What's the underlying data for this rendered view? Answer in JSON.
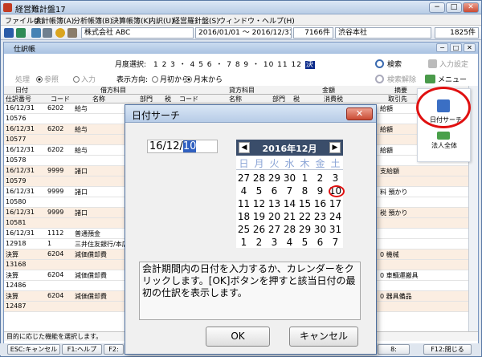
{
  "app": {
    "title": "経営難計盤17",
    "min": "−",
    "max": "□",
    "close": "✕"
  },
  "menu": [
    "ファイル(F)",
    "会計帳簿(A)",
    "分析帳簿(B)",
    "決算帳簿(K)",
    "内訳(U)",
    "経営羅針盤(S)",
    "ウィンドウ・ヘルプ(H)"
  ],
  "toolbar": {
    "company": "株式会社 ABC",
    "period": "2016/01/01 ～ 2016/12/31",
    "count": "7166件",
    "branch": "渋谷本社",
    "count2": "1825件"
  },
  "journal": {
    "title": "仕訳帳",
    "month_label": "月度選択:",
    "months": "1 2 3 ・ 4 5 6 ・ 7 8 9 ・ 10 11 12",
    "month_selected": "決",
    "direction_label": "表示方向:",
    "from_start": "月初から",
    "from_end": "月末から",
    "process_label": "処理",
    "reference": "参照",
    "input": "入力",
    "search": "検索",
    "search_amend": "検索解除",
    "input_settings": "入力設定",
    "menu": "メニュー",
    "headers_top": [
      "日付",
      "借方科目",
      "貸方科目",
      "金額",
      "摘要"
    ],
    "headers_bottom": [
      "仕訳番号",
      "コード",
      "名称",
      "部門",
      "税",
      "コード",
      "名称",
      "部門",
      "税",
      "消費税",
      "取引先"
    ],
    "rows": [
      {
        "date": "16/12/31",
        "code": "6202",
        "name": "給与",
        "memo": "給額"
      },
      {
        "date": "10576",
        "code": "",
        "name": "",
        "memo": ""
      },
      {
        "date": "16/12/31",
        "code": "6202",
        "name": "給与",
        "memo": "給額"
      },
      {
        "date": "10577",
        "code": "",
        "name": "",
        "memo": ""
      },
      {
        "date": "16/12/31",
        "code": "6202",
        "name": "給与",
        "memo": "給額"
      },
      {
        "date": "10578",
        "code": "",
        "name": "",
        "memo": ""
      },
      {
        "date": "16/12/31",
        "code": "9999",
        "name": "諸口",
        "memo": "支給額"
      },
      {
        "date": "10579",
        "code": "",
        "name": "",
        "memo": ""
      },
      {
        "date": "16/12/31",
        "code": "9999",
        "name": "諸口",
        "memo": "料 預かり"
      },
      {
        "date": "10580",
        "code": "",
        "name": "",
        "memo": ""
      },
      {
        "date": "16/12/31",
        "code": "9999",
        "name": "諸口",
        "memo": "税 預かり"
      },
      {
        "date": "10581",
        "code": "",
        "name": "",
        "memo": ""
      },
      {
        "date": "16/12/31",
        "code": "1112",
        "name": "普通預金",
        "memo": ""
      },
      {
        "date": "12918",
        "code": "1",
        "name": "三井住友銀行/本店",
        "memo": ""
      },
      {
        "date": "決算",
        "code": "6204",
        "name": "減価償却費",
        "memo": "0 機械"
      },
      {
        "date": "13168",
        "code": "",
        "name": "",
        "memo": ""
      },
      {
        "date": "決算",
        "code": "6204",
        "name": "減価償却費",
        "memo": "0 車輌運搬具"
      },
      {
        "date": "12486",
        "code": "",
        "name": "",
        "memo": ""
      },
      {
        "date": "決算",
        "code": "6204",
        "name": "減価償却費",
        "memo": "0 器具備品"
      },
      {
        "date": "12487",
        "code": "",
        "name": "",
        "memo": ""
      }
    ],
    "status": "目的に応じた機能を選択します。"
  },
  "side_panel": {
    "date_search": "日付サーチ",
    "corp_all": "法人全体"
  },
  "fnkeys": {
    "esc": "ESC:キャンセル",
    "f1": "F1:ヘルプ",
    "f2": "F2:",
    "f8": "8:",
    "f12": "F12:閉じる"
  },
  "dialog": {
    "title": "日付サーチ",
    "close": "✕",
    "date_prefix": "16/12/",
    "date_selected": "10",
    "calendar": {
      "month": "2016年12月",
      "prev": "◀",
      "next": "▶",
      "weekdays": [
        "日",
        "月",
        "火",
        "水",
        "木",
        "金",
        "土"
      ],
      "weeks": [
        [
          "27",
          "28",
          "29",
          "30",
          "1",
          "2",
          "3"
        ],
        [
          "4",
          "5",
          "6",
          "7",
          "8",
          "9",
          "10"
        ],
        [
          "11",
          "12",
          "13",
          "14",
          "15",
          "16",
          "17"
        ],
        [
          "18",
          "19",
          "20",
          "21",
          "22",
          "23",
          "24"
        ],
        [
          "25",
          "26",
          "27",
          "28",
          "29",
          "30",
          "31"
        ],
        [
          "1",
          "2",
          "3",
          "4",
          "5",
          "6",
          "7"
        ]
      ],
      "selected_day": "10"
    },
    "message": "会計期間内の日付を入力するか、カレンダーをクリックします。[OK]ボタンを押すと該当日付の最初の仕訳を表示します。",
    "ok": "OK",
    "cancel": "キャンセル"
  },
  "colors": {
    "accent": "#3a4d6a",
    "highlight": "#e01010",
    "selection": "#3060c0"
  }
}
